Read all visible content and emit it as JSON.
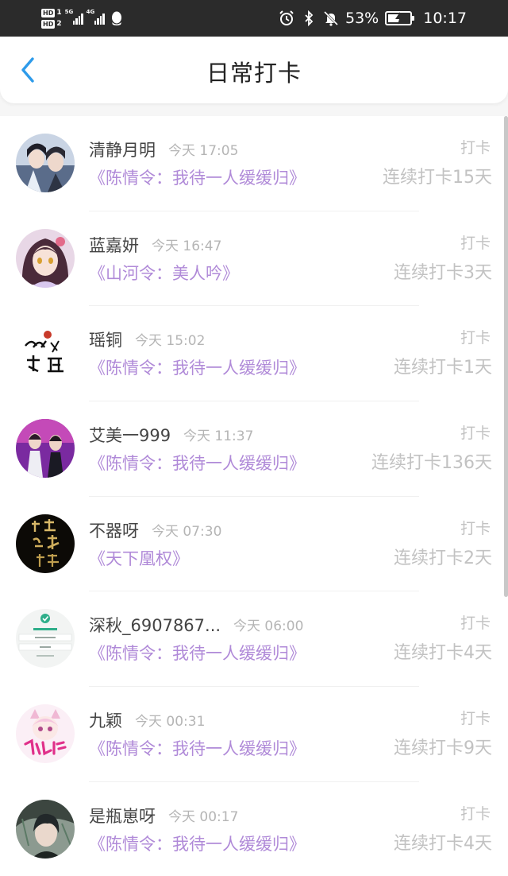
{
  "status_bar": {
    "hd1": "HD",
    "hd1_num": "1",
    "hd2": "HD",
    "hd2_num": "2",
    "net1": "5G",
    "net2": "4G",
    "battery_pct": "53%",
    "battery_level": 0.53,
    "time": "10:17",
    "icons": [
      "qq-icon",
      "alarm-icon",
      "bluetooth-icon",
      "mute-bell-icon",
      "battery-charging-icon"
    ]
  },
  "header": {
    "title": "日常打卡",
    "back_icon": "chevron-left-icon",
    "accent": "#2e9bea"
  },
  "colors": {
    "book": "#b08ad8",
    "muted": "#c2c2c2",
    "name": "#444444"
  },
  "entries": [
    {
      "name": "清静月明",
      "time": "今天 17:05",
      "book": "《陈情令：我待一人缓缓归》",
      "label": "打卡",
      "streak": "连续打卡15天"
    },
    {
      "name": "蓝嘉妍",
      "time": "今天 16:47",
      "book": "《山河令：美人吟》",
      "label": "打卡",
      "streak": "连续打卡3天"
    },
    {
      "name": "瑶铜",
      "time": "今天 15:02",
      "book": "《陈情令：我待一人缓缓归》",
      "label": "打卡",
      "streak": "连续打卡1天"
    },
    {
      "name": "艾美一999",
      "time": "今天 11:37",
      "book": "《陈情令：我待一人缓缓归》",
      "label": "打卡",
      "streak": "连续打卡136天"
    },
    {
      "name": "不器呀",
      "time": "今天 07:30",
      "book": "《天下凰权》",
      "label": "打卡",
      "streak": "连续打卡2天"
    },
    {
      "name": "深秋_6907867...",
      "time": "今天 06:00",
      "book": "《陈情令：我待一人缓缓归》",
      "label": "打卡",
      "streak": "连续打卡4天"
    },
    {
      "name": "九颖",
      "time": "今天 00:31",
      "book": "《陈情令：我待一人缓缓归》",
      "label": "打卡",
      "streak": "连续打卡9天"
    },
    {
      "name": "是瓶崽呀",
      "time": "今天 00:17",
      "book": "《陈情令：我待一人缓缓归》",
      "label": "打卡",
      "streak": "连续打卡4天"
    }
  ]
}
